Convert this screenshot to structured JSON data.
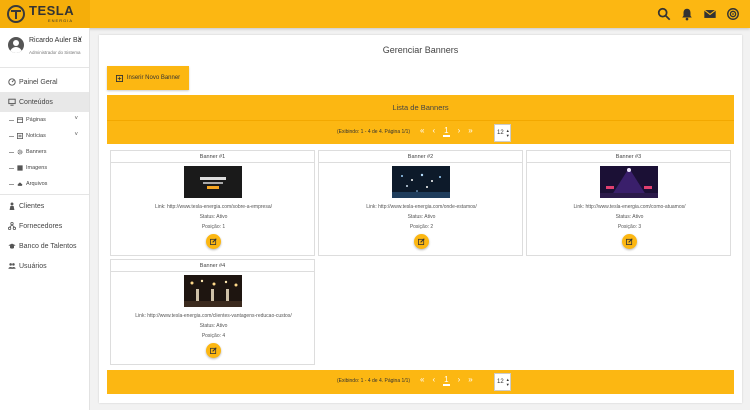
{
  "brand": {
    "name": "TESLA",
    "sub": "ENERGIA"
  },
  "user": {
    "name": "Ricardo Auler Ba",
    "role": "Administrador do Sistema"
  },
  "nav": {
    "painel": "Painel Geral",
    "conteudos": "Conteúdos",
    "sub": {
      "paginas": "Páginas",
      "noticias": "Notícias",
      "banners": "Banners",
      "imagens": "Imagens",
      "arquivos": "Arquivos"
    },
    "clientes": "Clientes",
    "fornecedores": "Fornecedores",
    "talentos": "Banco de Talentos",
    "usuarios": "Usuários"
  },
  "main": {
    "title": "Gerenciar Banners",
    "insert_label": "Inserir Novo Banner",
    "list_title": "Lista de Banners",
    "pager_info": "(Exibindo: 1 - 4 de 4. Página 1/1)",
    "first": "«",
    "prev": "‹",
    "current_page": "1",
    "next": "›",
    "last": "»",
    "per_page": "12"
  },
  "banners": [
    {
      "title": "Banner #1",
      "link": "Link: http://www.tesla-energia.com/sobre-a-empresa/",
      "status": "Status: Ativo",
      "pos": "Posição: 1"
    },
    {
      "title": "Banner #2",
      "link": "Link: http://www.tesla-energia.com/onde-estamos/",
      "status": "Status: Ativo",
      "pos": "Posição: 2"
    },
    {
      "title": "Banner #3",
      "link": "Link: http://www.tesla-energia.com/como-atuamos/",
      "status": "Status: Ativo",
      "pos": "Posição: 3"
    },
    {
      "title": "Banner #4",
      "link": "Link: http://www.tesla-energia.com/clientes-vantagens-reducao-custos/",
      "status": "Status: Ativo",
      "pos": "Posição: 4"
    }
  ],
  "colors": {
    "accent": "#fcb712",
    "accent_dark": "#f5ae0a"
  },
  "icons": [
    "search-icon",
    "bell-icon",
    "mail-icon",
    "rss-icon",
    "edit-icon"
  ]
}
